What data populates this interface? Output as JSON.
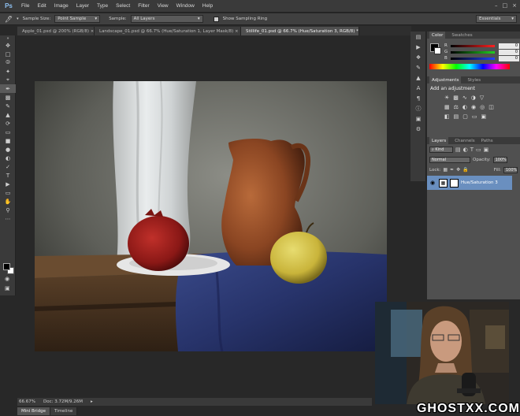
{
  "app": {
    "logo": "Ps"
  },
  "menu": [
    "File",
    "Edit",
    "Image",
    "Layer",
    "Type",
    "Select",
    "Filter",
    "View",
    "Window",
    "Help"
  ],
  "window_controls": [
    "–",
    "□",
    "×"
  ],
  "options": {
    "sample_size_label": "Sample Size:",
    "sample_size_value": "Point Sample",
    "sample_label": "Sample:",
    "sample_value": "All Layers",
    "show_ring_label": "Show Sampling Ring",
    "workspace": "Essentials"
  },
  "tabs": [
    {
      "label": "Apple_01.psd @ 200% (RGB/8) ×",
      "active": false
    },
    {
      "label": "Landscape_01.psd @ 66.7% (Hue/Saturation 1, Layer Mask/8) ×",
      "active": false
    },
    {
      "label": "Stillife_01.psd @ 66.7% (Hue/Saturation 3, RGB/8) * ×",
      "active": true
    }
  ],
  "status": {
    "zoom": "66.67%",
    "doc": "Doc: 3.72M/9.26M",
    "arrow": "▸"
  },
  "bridge_tabs": [
    {
      "label": "Mini Bridge",
      "active": true
    },
    {
      "label": "Timeline",
      "active": false
    }
  ],
  "color_panel": {
    "tabs": [
      "Color",
      "Swatches"
    ],
    "channels": [
      {
        "name": "R",
        "value": "0",
        "grad": "#ff2020"
      },
      {
        "name": "G",
        "value": "0",
        "grad": "#20d020"
      },
      {
        "name": "B",
        "value": "0",
        "grad": "#2040ff"
      }
    ]
  },
  "adjust_panel": {
    "tabs": [
      "Adjustments",
      "Styles"
    ],
    "title": "Add an adjustment"
  },
  "layers_panel": {
    "tabs": [
      "Layers",
      "Channels",
      "Paths"
    ],
    "kind": "⌕ Kind",
    "blend": "Normal",
    "opacity_label": "Opacity:",
    "opacity": "100%",
    "lock_label": "Lock:",
    "fill_label": "Fill:",
    "fill": "100%",
    "layer_name": "Hue/Saturation 3"
  },
  "watermark": "GHOSTXX.COM",
  "colors": {
    "accent": "#6a8fbf",
    "chrome": "#3a3a3a",
    "panel": "#505050"
  }
}
